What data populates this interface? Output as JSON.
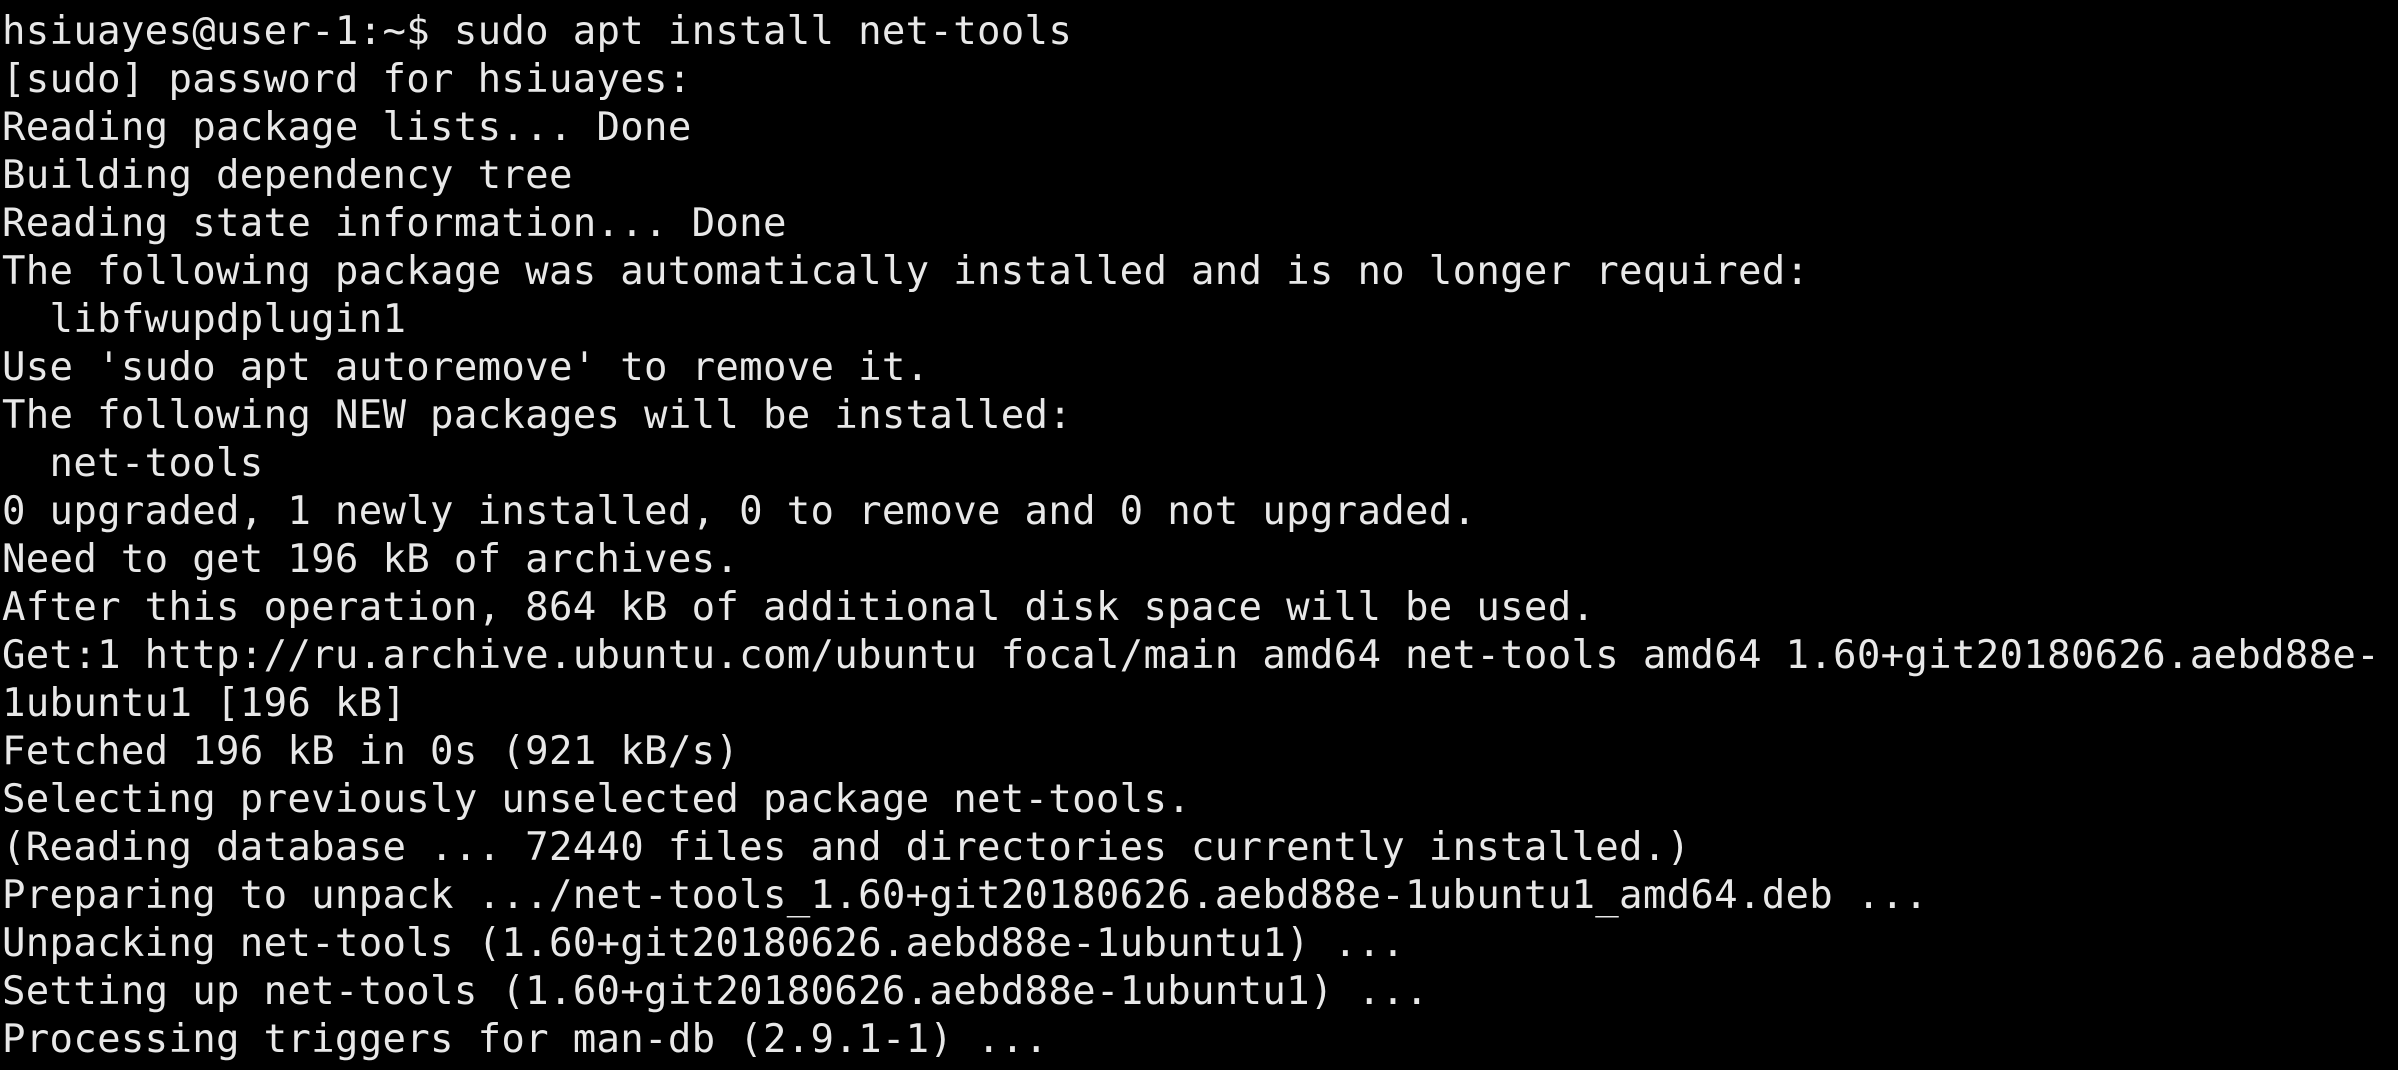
{
  "terminal": {
    "colors": {
      "background": "#000000",
      "foreground": "#e8e8e8"
    },
    "lines": [
      "hsiuayes@user-1:~$ sudo apt install net-tools",
      "[sudo] password for hsiuayes:",
      "Reading package lists... Done",
      "Building dependency tree",
      "Reading state information... Done",
      "The following package was automatically installed and is no longer required:",
      "  libfwupdplugin1",
      "Use 'sudo apt autoremove' to remove it.",
      "The following NEW packages will be installed:",
      "  net-tools",
      "0 upgraded, 1 newly installed, 0 to remove and 0 not upgraded.",
      "Need to get 196 kB of archives.",
      "After this operation, 864 kB of additional disk space will be used.",
      "Get:1 http://ru.archive.ubuntu.com/ubuntu focal/main amd64 net-tools amd64 1.60+git20180626.aebd88e-",
      "1ubuntu1 [196 kB]",
      "Fetched 196 kB in 0s (921 kB/s)",
      "Selecting previously unselected package net-tools.",
      "(Reading database ... 72440 files and directories currently installed.)",
      "Preparing to unpack .../net-tools_1.60+git20180626.aebd88e-1ubuntu1_amd64.deb ...",
      "Unpacking net-tools (1.60+git20180626.aebd88e-1ubuntu1) ...",
      "Setting up net-tools (1.60+git20180626.aebd88e-1ubuntu1) ...",
      "Processing triggers for man-db (2.9.1-1) ..."
    ]
  }
}
